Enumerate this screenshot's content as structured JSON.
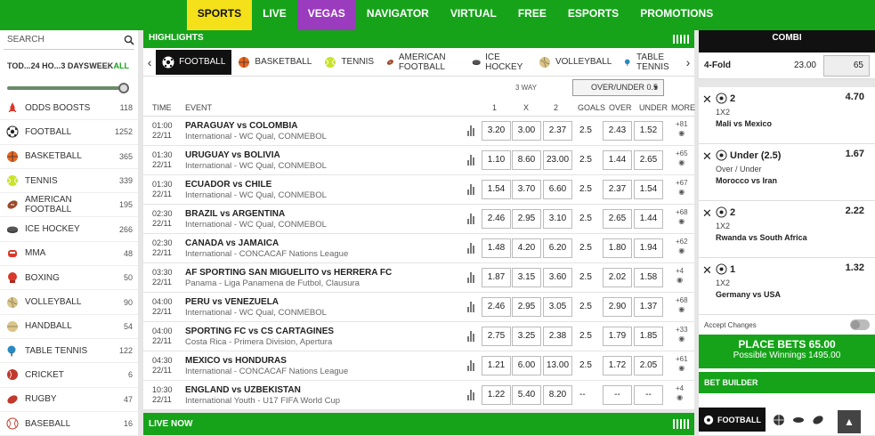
{
  "nav": [
    "SPORTS",
    "LIVE",
    "VEGAS",
    "NAVIGATOR",
    "VIRTUAL",
    "FREE",
    "ESPORTS",
    "PROMOTIONS"
  ],
  "sidebar": {
    "search": "SEARCH",
    "periods": [
      "TOD...",
      "24 HO...",
      "3 DAYS",
      "WEEK",
      "ALL"
    ],
    "sports": [
      {
        "label": "ODDS BOOSTS",
        "count": "118",
        "icon": "rocket-icon"
      },
      {
        "label": "FOOTBALL",
        "count": "1252",
        "icon": "football-icon"
      },
      {
        "label": "BASKETBALL",
        "count": "365",
        "icon": "basketball-icon"
      },
      {
        "label": "TENNIS",
        "count": "339",
        "icon": "tennis-icon"
      },
      {
        "label": "AMERICAN FOOTBALL",
        "count": "195",
        "icon": "american-football-icon"
      },
      {
        "label": "ICE HOCKEY",
        "count": "266",
        "icon": "puck-icon"
      },
      {
        "label": "MMA",
        "count": "48",
        "icon": "glove-icon"
      },
      {
        "label": "BOXING",
        "count": "50",
        "icon": "boxing-icon"
      },
      {
        "label": "VOLLEYBALL",
        "count": "90",
        "icon": "volleyball-icon"
      },
      {
        "label": "HANDBALL",
        "count": "54",
        "icon": "handball-icon"
      },
      {
        "label": "TABLE TENNIS",
        "count": "122",
        "icon": "table-tennis-icon"
      },
      {
        "label": "CRICKET",
        "count": "6",
        "icon": "cricket-icon"
      },
      {
        "label": "RUGBY",
        "count": "47",
        "icon": "rugby-icon"
      },
      {
        "label": "BASEBALL",
        "count": "16",
        "icon": "baseball-icon"
      }
    ]
  },
  "main": {
    "highlights": "HIGHLIGHTS",
    "tabs": [
      "FOOTBALL",
      "BASKETBALL",
      "TENNIS",
      "AMERICAN FOOTBALL",
      "ICE HOCKEY",
      "VOLLEYBALL",
      "TABLE TENNIS"
    ],
    "three_way": "3 WAY",
    "market_select": "OVER/UNDER 0.5",
    "cols": {
      "time": "TIME",
      "event": "EVENT",
      "c1": "1",
      "cx": "X",
      "c2": "2",
      "goals": "GOALS",
      "over": "OVER",
      "under": "UNDER",
      "more": "MORE"
    },
    "events": [
      {
        "time": "01:00",
        "date": "22/11",
        "teams": "PARAGUAY vs COLOMBIA",
        "league": "International - WC Qual, CONMEBOL",
        "o1": "3.20",
        "ox": "3.00",
        "o2": "2.37",
        "goals": "2.5",
        "over": "2.43",
        "under": "1.52",
        "more": "+81"
      },
      {
        "time": "01:30",
        "date": "22/11",
        "teams": "URUGUAY vs BOLIVIA",
        "league": "International - WC Qual, CONMEBOL",
        "o1": "1.10",
        "ox": "8.60",
        "o2": "23.00",
        "goals": "2.5",
        "over": "1.44",
        "under": "2.65",
        "more": "+65"
      },
      {
        "time": "01:30",
        "date": "22/11",
        "teams": "ECUADOR vs CHILE",
        "league": "International - WC Qual, CONMEBOL",
        "o1": "1.54",
        "ox": "3.70",
        "o2": "6.60",
        "goals": "2.5",
        "over": "2.37",
        "under": "1.54",
        "more": "+67"
      },
      {
        "time": "02:30",
        "date": "22/11",
        "teams": "BRAZIL vs ARGENTINA",
        "league": "International - WC Qual, CONMEBOL",
        "o1": "2.46",
        "ox": "2.95",
        "o2": "3.10",
        "goals": "2.5",
        "over": "2.65",
        "under": "1.44",
        "more": "+68"
      },
      {
        "time": "02:30",
        "date": "22/11",
        "teams": "CANADA vs JAMAICA",
        "league": "International - CONCACAF Nations League",
        "o1": "1.48",
        "ox": "4.20",
        "o2": "6.20",
        "goals": "2.5",
        "over": "1.80",
        "under": "1.94",
        "more": "+62"
      },
      {
        "time": "03:30",
        "date": "22/11",
        "teams": "AF SPORTING SAN MIGUELITO vs HERRERA FC",
        "league": "Panama - Liga Panamena de Futbol, Clausura",
        "o1": "1.87",
        "ox": "3.15",
        "o2": "3.60",
        "goals": "2.5",
        "over": "2.02",
        "under": "1.58",
        "more": "+4"
      },
      {
        "time": "04:00",
        "date": "22/11",
        "teams": "PERU vs VENEZUELA",
        "league": "International - WC Qual, CONMEBOL",
        "o1": "2.46",
        "ox": "2.95",
        "o2": "3.05",
        "goals": "2.5",
        "over": "2.90",
        "under": "1.37",
        "more": "+68"
      },
      {
        "time": "04:00",
        "date": "22/11",
        "teams": "SPORTING FC vs CS CARTAGINES",
        "league": "Costa Rica - Primera Division, Apertura",
        "o1": "2.75",
        "ox": "3.25",
        "o2": "2.38",
        "goals": "2.5",
        "over": "1.79",
        "under": "1.85",
        "more": "+33"
      },
      {
        "time": "04:30",
        "date": "22/11",
        "teams": "MEXICO vs HONDURAS",
        "league": "International - CONCACAF Nations League",
        "o1": "1.21",
        "ox": "6.00",
        "o2": "13.00",
        "goals": "2.5",
        "over": "1.72",
        "under": "2.05",
        "more": "+61"
      },
      {
        "time": "10:30",
        "date": "22/11",
        "teams": "ENGLAND vs UZBEKISTAN",
        "league": "International Youth - U17 FIFA World Cup",
        "o1": "1.22",
        "ox": "5.40",
        "o2": "8.20",
        "goals": "--",
        "over": "--",
        "under": "--",
        "more": "+4"
      }
    ],
    "live_now": "LIVE NOW"
  },
  "slip": {
    "combi": "COMBI",
    "fold": "4-Fold",
    "fold_odds": "23.00",
    "stake": "65",
    "bets": [
      {
        "sel": "2",
        "odds": "4.70",
        "market": "1X2",
        "event": "Mali vs Mexico"
      },
      {
        "sel": "Under (2.5)",
        "odds": "1.67",
        "market": "Over / Under",
        "event": "Morocco vs Iran"
      },
      {
        "sel": "2",
        "odds": "2.22",
        "market": "1X2",
        "event": "Rwanda vs South Africa"
      },
      {
        "sel": "1",
        "odds": "1.32",
        "market": "1X2",
        "event": "Germany vs USA"
      }
    ],
    "accept": "Accept Changes",
    "place": "PLACE BETS 65.00",
    "winnings": "Possible Winnings 1495.00",
    "bet_builder": "BET BUILDER",
    "bb_tab": "FOOTBALL"
  },
  "colors": {
    "brand_green": "#16a31a",
    "sports_yellow": "#f5e11a",
    "vegas_purple": "#9b3bbd"
  }
}
